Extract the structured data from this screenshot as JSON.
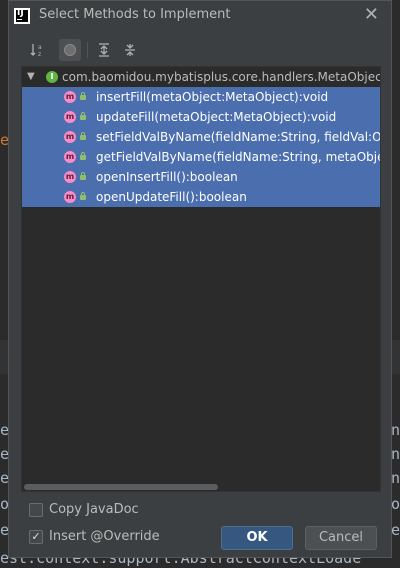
{
  "background": {
    "orange_char": "e",
    "lines": [
      {
        "left": "e",
        "right": "in"
      },
      {
        "left": "e",
        "right": "in"
      },
      {
        "left": "e",
        "right": "in"
      },
      {
        "left": "o",
        "right": "to"
      },
      {
        "left": "e",
        "right": "e"
      }
    ],
    "bottom_line": "est.context.support.AbstractContextLoade"
  },
  "dialog": {
    "title": "Select Methods to Implement",
    "toolbar": {
      "sort_icon": "sort-alpha-icon",
      "expand_icon": "expand-all-icon",
      "collapse_icon": "collapse-all-icon"
    },
    "tree": {
      "class_name": "com.baomidou.mybatisplus.core.handlers.MetaObjectH",
      "methods": [
        "insertFill(metaObject:MetaObject):void",
        "updateFill(metaObject:MetaObject):void",
        "setFieldValByName(fieldName:String, fieldVal:Ob",
        "getFieldValByName(fieldName:String, metaObjec",
        "openInsertFill():boolean",
        "openUpdateFill():boolean"
      ]
    },
    "options": {
      "copy_javadoc": {
        "label": "Copy JavaDoc",
        "checked": false
      },
      "insert_override": {
        "label": "Insert @Override",
        "checked": true
      }
    },
    "buttons": {
      "ok": "OK",
      "cancel": "Cancel"
    }
  }
}
